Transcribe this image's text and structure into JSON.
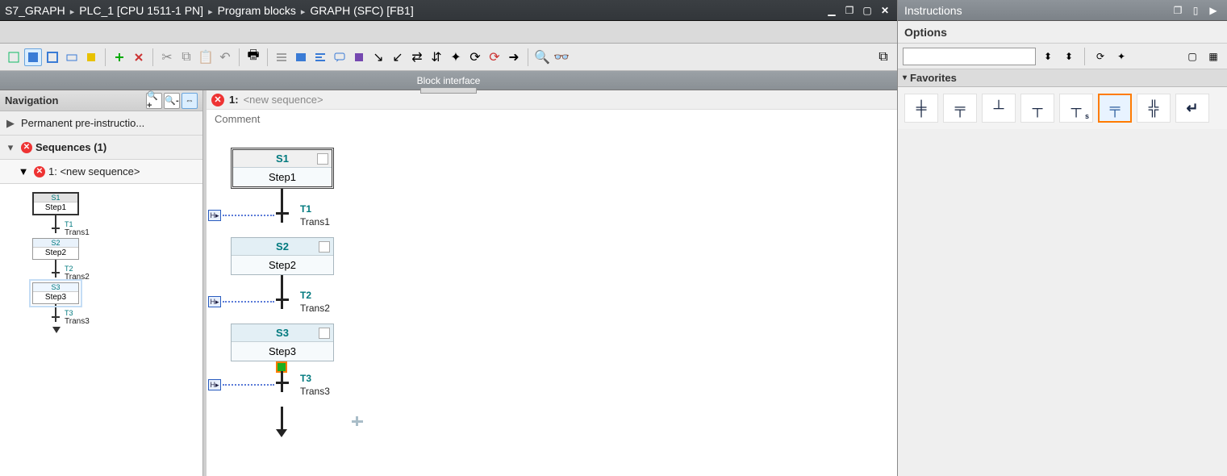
{
  "breadcrumb": {
    "i0": "S7_GRAPH",
    "i1": "PLC_1 [CPU 1511-1 PN]",
    "i2": "Program blocks",
    "i3": "GRAPH (SFC) [FB1]"
  },
  "block_interface_label": "Block interface",
  "navigation": {
    "title": "Navigation",
    "rows": {
      "pre": "Permanent pre-instructio...",
      "seqs": "Sequences (1)",
      "seq1": "1: <new sequence>"
    },
    "thumb": {
      "s1_id": "S1",
      "s1_name": "Step1",
      "t1_id": "T1",
      "t1_name": "Trans1",
      "s2_id": "S2",
      "s2_name": "Step2",
      "t2_id": "T2",
      "t2_name": "Trans2",
      "s3_id": "S3",
      "s3_name": "Step3",
      "t3_id": "T3",
      "t3_name": "Trans3"
    }
  },
  "canvas": {
    "num": "1:",
    "subtitle": "<new sequence>",
    "comment": "Comment",
    "s1_id": "S1",
    "s1_name": "Step1",
    "t1_id": "T1",
    "t1_name": "Trans1",
    "s2_id": "S2",
    "s2_name": "Step2",
    "t2_id": "T2",
    "t2_name": "Trans2",
    "s3_id": "S3",
    "s3_name": "Step3",
    "t3_id": "T3",
    "t3_name": "Trans3"
  },
  "instructions": {
    "title": "Instructions",
    "options": "Options",
    "favorites": "Favorites"
  }
}
